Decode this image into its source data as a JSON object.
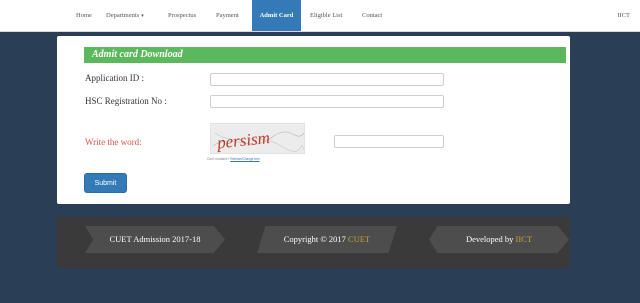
{
  "nav": {
    "items": [
      {
        "label": "Home"
      },
      {
        "label": "Departments",
        "caret": "▾"
      },
      {
        "label": "Prospectus"
      },
      {
        "label": "Payment"
      },
      {
        "label": "Admit Card"
      },
      {
        "label": "Eligible List"
      },
      {
        "label": "Contact"
      }
    ],
    "right_label": "IICT"
  },
  "form": {
    "title": "Admit card Download",
    "application_id_label": "Application ID :",
    "application_id_value": "",
    "hsc_label": "HSC Registration No :",
    "hsc_value": "",
    "captcha_label": "Write the word:",
    "captcha_word": "persism",
    "captcha_help_prefix": "Can't readable?",
    "captcha_help_link": "Refresh/Change text",
    "captcha_answer": "",
    "submit_label": "Submit"
  },
  "footer": {
    "admission": "CUET Admission 2017-18",
    "copyright_prefix": "Copyright © 2017",
    "copyright_org": "CUET",
    "developed_prefix": "Developed by",
    "developed_org": "IICT"
  },
  "colors": {
    "nav_active": "#337ab7",
    "panel_header": "#5cb85c",
    "captcha_text": "#c0392b",
    "footer_highlight": "#c8a232",
    "page_background": "#2a3f55"
  }
}
